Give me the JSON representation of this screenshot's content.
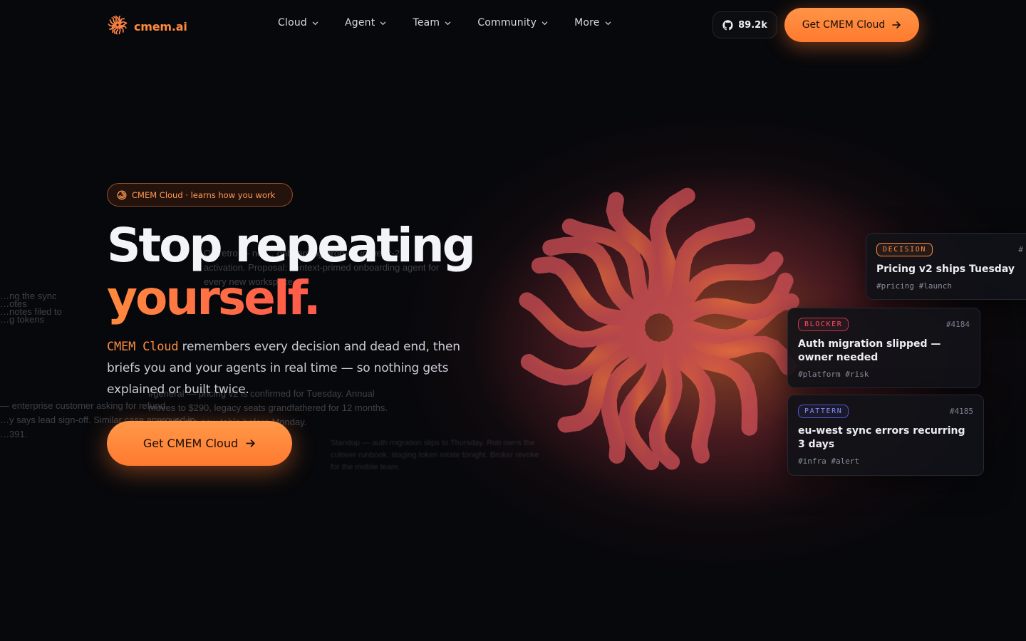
{
  "nav": {
    "logo_text": "cmem.ai",
    "menu": [
      {
        "label": "Cloud"
      },
      {
        "label": "Agent"
      },
      {
        "label": "Team"
      },
      {
        "label": "Community"
      },
      {
        "label": "More"
      }
    ],
    "github_stars": "89.2k",
    "cta_label": "Get CMEM Cloud"
  },
  "hero": {
    "badge": "CMEM Cloud · learns how you work",
    "title_line1": "Stop repeating",
    "title_line2": "yourself.",
    "sub_brand": "CMEM Cloud",
    "sub_text": " remembers every decision and dead end, then briefs you and your agents in real time — so nothing gets explained or built twice.",
    "cta_label": "Get CMEM Cloud"
  },
  "ghost_text": {
    "g1": [
      "Q3 retro — no … onboarding drop-off in week-2",
      "activation. Proposal: context-primed onboarding agent for",
      "every new workspace."
    ],
    "g2": [
      "…ng the sync",
      "…otes",
      "…notes filed to",
      "…g tokens"
    ],
    "g3": [
      "#general — pricing v2 is confirmed for Tuesday. Annual",
      "moves to $290, legacy seats grandfathered for 12 months.",
      "…needs the new table before Monday."
    ],
    "g4": [
      "— enterprise customer asking for refund",
      "…y says lead sign-off. Similar case approved in",
      "…391."
    ],
    "g5": [
      "Standup — auth migration slips to Thursday. Rob owns the",
      "cutover runbook, staging token rotate tonight. Broker revoke",
      "for the mobile team."
    ]
  },
  "cards": [
    {
      "tag": "DECISION",
      "id": "#",
      "title": "Pricing v2 ships Tuesday",
      "tags": "#pricing #launch"
    },
    {
      "tag": "BLOCKER",
      "id": "#4184",
      "title": "Auth migration slipped — owner needed",
      "tags": "#platform #risk"
    },
    {
      "tag": "PATTERN",
      "id": "#4185",
      "title": "eu-west sync errors recurring 3 days",
      "tags": "#infra #alert"
    }
  ],
  "colors": {
    "accent": "#ff8a3d",
    "accent_red": "#f04a5a",
    "background": "#07080b"
  },
  "icons": {
    "logo": "sunburst-logo-icon",
    "github": "github-icon",
    "arrow": "arrow-right-icon",
    "badge": "spiral-icon",
    "chevron": "chevron-down-icon"
  }
}
